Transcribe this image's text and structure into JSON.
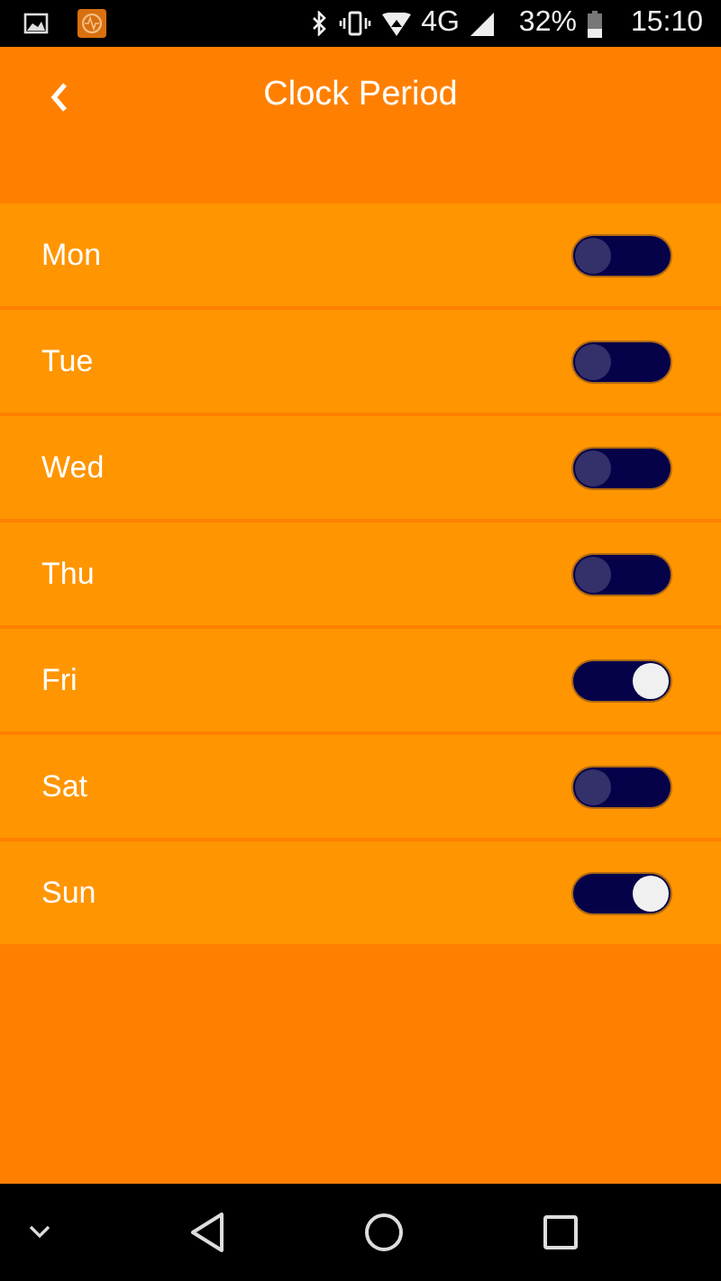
{
  "status_bar": {
    "network": "4G",
    "battery": "32%",
    "time": "15:10"
  },
  "header": {
    "title": "Clock Period"
  },
  "days": [
    {
      "label": "Mon",
      "on": false
    },
    {
      "label": "Tue",
      "on": false
    },
    {
      "label": "Wed",
      "on": false
    },
    {
      "label": "Thu",
      "on": false
    },
    {
      "label": "Fri",
      "on": true
    },
    {
      "label": "Sat",
      "on": false
    },
    {
      "label": "Sun",
      "on": true
    }
  ]
}
